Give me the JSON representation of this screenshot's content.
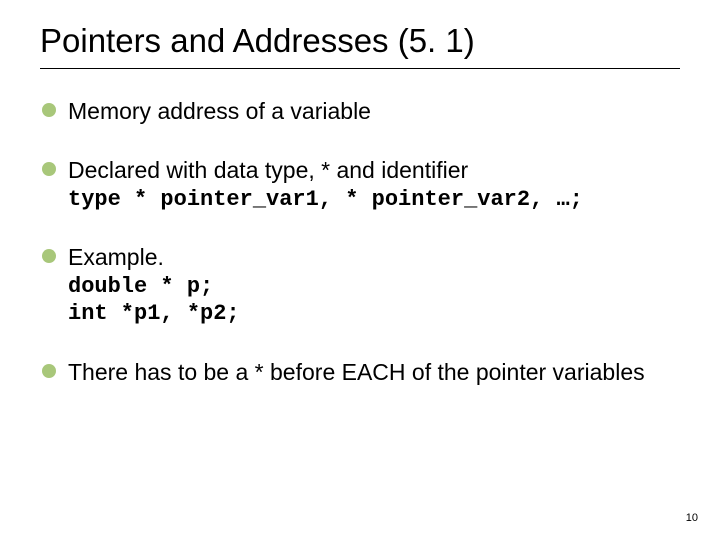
{
  "title": "Pointers and Addresses (5. 1)",
  "bullets": {
    "b1": "Memory address of a variable",
    "b2": "Declared with data type, * and identifier",
    "b2code": "type * pointer_var1, * pointer_var2, …;",
    "b3": "Example.",
    "b3code1": "double * p;",
    "b3code2": "int *p1, *p2;",
    "b4": "There has to be a * before EACH of the pointer variables"
  },
  "page_number": "10"
}
